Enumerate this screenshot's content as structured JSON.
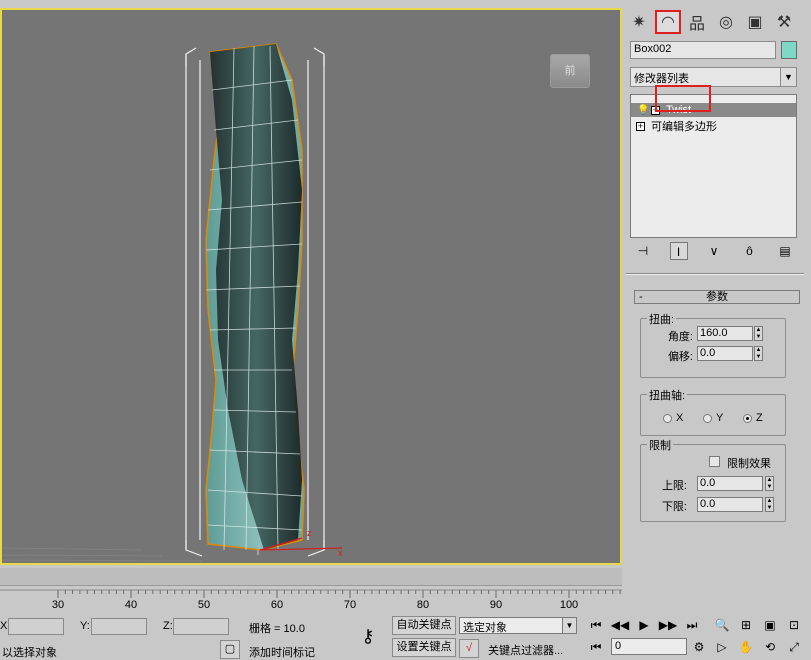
{
  "viewport": {
    "viewcube_label": "前",
    "selection_color": "#e08a00",
    "object_color": "#7fd7c8",
    "border_color": "#e8d84a"
  },
  "command_panel": {
    "tabs": [
      {
        "name": "create",
        "icon": "✷"
      },
      {
        "name": "modify",
        "icon": "◠"
      },
      {
        "name": "hierarchy",
        "icon": "品"
      },
      {
        "name": "motion",
        "icon": "◎"
      },
      {
        "name": "display",
        "icon": "▣"
      },
      {
        "name": "utilities",
        "icon": "⚒"
      }
    ],
    "object_name": "Box002",
    "modifier_list": "修改器列表",
    "stack": [
      {
        "label": "Twist",
        "selected": true
      },
      {
        "label": "可编辑多边形",
        "selected": false
      }
    ],
    "stack_tools": [
      "⊣",
      "I",
      "∨",
      "ô",
      "▤"
    ]
  },
  "params": {
    "rollout_title": "参数",
    "twist_group": "扭曲:",
    "angle_label": "角度:",
    "angle_value": "160.0",
    "bias_label": "偏移:",
    "bias_value": "0.0",
    "axis_group": "扭曲轴:",
    "axes": [
      {
        "label": "X",
        "checked": false
      },
      {
        "label": "Y",
        "checked": false
      },
      {
        "label": "Z",
        "checked": true
      }
    ],
    "limits_group": "限制",
    "limit_effect_label": "限制效果",
    "upper_label": "上限:",
    "upper_value": "0.0",
    "lower_label": "下限:",
    "lower_value": "0.0"
  },
  "timeline": {
    "ticks": [
      "30",
      "40",
      "50",
      "60",
      "70",
      "80",
      "90",
      "100"
    ]
  },
  "status": {
    "x_label": "X:",
    "y_label": "Y:",
    "z_label": "Z:",
    "grid_text": "栅格 = 10.0",
    "prompt_text": "以选择对象",
    "auto_key": "自动关键点",
    "set_key": "设置关键点",
    "key_filter_select": "选定对象",
    "key_filters": "关键点过滤器...",
    "add_time_tag": "添加时间标记",
    "frame_value": "0"
  }
}
